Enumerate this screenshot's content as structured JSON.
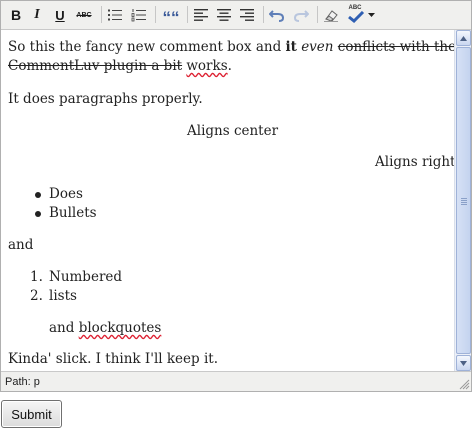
{
  "toolbar": {
    "buttons": [
      {
        "id": "bold",
        "glyph": "B"
      },
      {
        "id": "italic",
        "glyph": "I"
      },
      {
        "id": "underline",
        "glyph": "U"
      },
      {
        "id": "strikethrough",
        "glyph": "ABC"
      },
      {
        "id": "bullet-list"
      },
      {
        "id": "numbered-list"
      },
      {
        "id": "blockquote",
        "glyph": "““"
      },
      {
        "id": "align-left"
      },
      {
        "id": "align-center"
      },
      {
        "id": "align-right"
      },
      {
        "id": "undo"
      },
      {
        "id": "redo"
      },
      {
        "id": "remove-format"
      },
      {
        "id": "spellcheck",
        "glyph": "ABC"
      }
    ]
  },
  "content": {
    "p1": {
      "text1": "So this the fancy new comment box and ",
      "bold": "it",
      "italic": "even",
      "strike_line1": "conflicts with the",
      "strike_line2": "CommentLuv plugin a bit",
      "spell_word": "works",
      "end": "."
    },
    "p2": "It does paragraphs properly.",
    "p3": "Aligns center",
    "p4": "Aligns right",
    "bullets": [
      "Does",
      "Bullets"
    ],
    "p5": "and",
    "numbered": [
      {
        "num": "1.",
        "text": "Numbered"
      },
      {
        "num": "2.",
        "text": "lists"
      }
    ],
    "blockquote": {
      "text1": "and ",
      "spell_word": "blockquotes"
    },
    "p6": "Kinda' slick. I think I'll keep it."
  },
  "statusbar": {
    "path": "Path: p"
  },
  "submit": {
    "label": "Submit"
  },
  "colors": {
    "accent_scroll": "#c4d3ef",
    "spell_underline": "#dd2233"
  }
}
